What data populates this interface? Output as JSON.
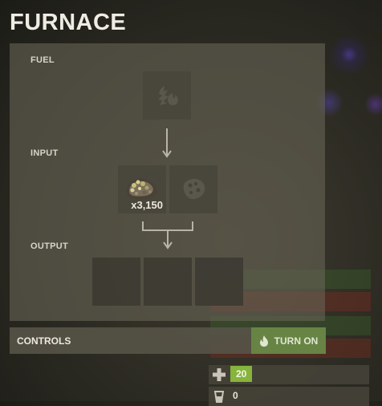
{
  "title": "FURNACE",
  "sections": {
    "fuel": "FUEL",
    "input": "INPUT",
    "output": "OUTPUT"
  },
  "input_slot": {
    "item_icon": "metal-ore-icon",
    "count": "x3,150"
  },
  "empty_input_icon": "ore-placeholder-icon",
  "fuel_icon": "wood-fuel-icon",
  "controls": {
    "label": "CONTROLS",
    "turn_on_label": "TURN ON",
    "turn_on_icon": "flame-icon"
  },
  "stats": {
    "health_value": "20",
    "water_value": "0"
  },
  "colors": {
    "turn_on_bg": "#6e9646",
    "health_badge": "#86b43c"
  }
}
